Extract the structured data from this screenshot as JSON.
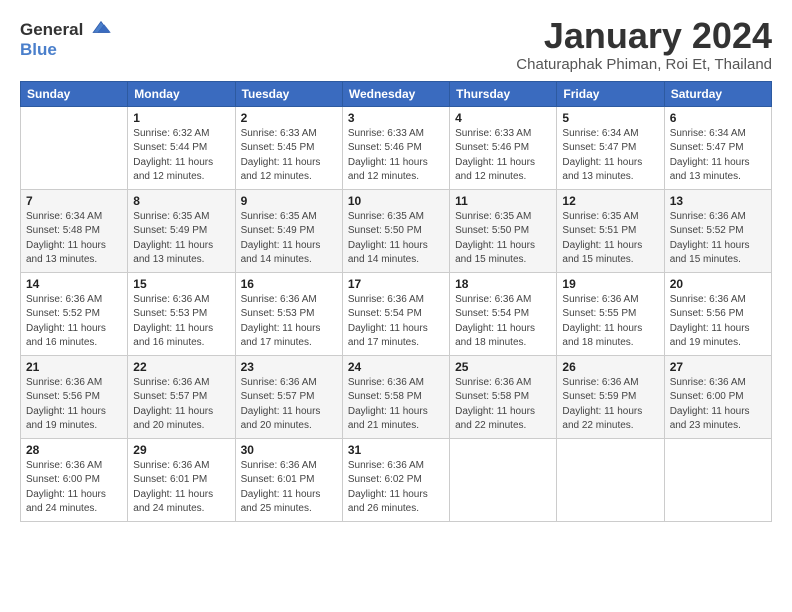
{
  "header": {
    "logo_line1": "General",
    "logo_line2": "Blue",
    "title": "January 2024",
    "subtitle": "Chaturaphak Phiman, Roi Et, Thailand"
  },
  "weekdays": [
    "Sunday",
    "Monday",
    "Tuesday",
    "Wednesday",
    "Thursday",
    "Friday",
    "Saturday"
  ],
  "weeks": [
    [
      {
        "day": "",
        "info": ""
      },
      {
        "day": "1",
        "info": "Sunrise: 6:32 AM\nSunset: 5:44 PM\nDaylight: 11 hours\nand 12 minutes."
      },
      {
        "day": "2",
        "info": "Sunrise: 6:33 AM\nSunset: 5:45 PM\nDaylight: 11 hours\nand 12 minutes."
      },
      {
        "day": "3",
        "info": "Sunrise: 6:33 AM\nSunset: 5:46 PM\nDaylight: 11 hours\nand 12 minutes."
      },
      {
        "day": "4",
        "info": "Sunrise: 6:33 AM\nSunset: 5:46 PM\nDaylight: 11 hours\nand 12 minutes."
      },
      {
        "day": "5",
        "info": "Sunrise: 6:34 AM\nSunset: 5:47 PM\nDaylight: 11 hours\nand 13 minutes."
      },
      {
        "day": "6",
        "info": "Sunrise: 6:34 AM\nSunset: 5:47 PM\nDaylight: 11 hours\nand 13 minutes."
      }
    ],
    [
      {
        "day": "7",
        "info": "Sunrise: 6:34 AM\nSunset: 5:48 PM\nDaylight: 11 hours\nand 13 minutes."
      },
      {
        "day": "8",
        "info": "Sunrise: 6:35 AM\nSunset: 5:49 PM\nDaylight: 11 hours\nand 13 minutes."
      },
      {
        "day": "9",
        "info": "Sunrise: 6:35 AM\nSunset: 5:49 PM\nDaylight: 11 hours\nand 14 minutes."
      },
      {
        "day": "10",
        "info": "Sunrise: 6:35 AM\nSunset: 5:50 PM\nDaylight: 11 hours\nand 14 minutes."
      },
      {
        "day": "11",
        "info": "Sunrise: 6:35 AM\nSunset: 5:50 PM\nDaylight: 11 hours\nand 15 minutes."
      },
      {
        "day": "12",
        "info": "Sunrise: 6:35 AM\nSunset: 5:51 PM\nDaylight: 11 hours\nand 15 minutes."
      },
      {
        "day": "13",
        "info": "Sunrise: 6:36 AM\nSunset: 5:52 PM\nDaylight: 11 hours\nand 15 minutes."
      }
    ],
    [
      {
        "day": "14",
        "info": "Sunrise: 6:36 AM\nSunset: 5:52 PM\nDaylight: 11 hours\nand 16 minutes."
      },
      {
        "day": "15",
        "info": "Sunrise: 6:36 AM\nSunset: 5:53 PM\nDaylight: 11 hours\nand 16 minutes."
      },
      {
        "day": "16",
        "info": "Sunrise: 6:36 AM\nSunset: 5:53 PM\nDaylight: 11 hours\nand 17 minutes."
      },
      {
        "day": "17",
        "info": "Sunrise: 6:36 AM\nSunset: 5:54 PM\nDaylight: 11 hours\nand 17 minutes."
      },
      {
        "day": "18",
        "info": "Sunrise: 6:36 AM\nSunset: 5:54 PM\nDaylight: 11 hours\nand 18 minutes."
      },
      {
        "day": "19",
        "info": "Sunrise: 6:36 AM\nSunset: 5:55 PM\nDaylight: 11 hours\nand 18 minutes."
      },
      {
        "day": "20",
        "info": "Sunrise: 6:36 AM\nSunset: 5:56 PM\nDaylight: 11 hours\nand 19 minutes."
      }
    ],
    [
      {
        "day": "21",
        "info": "Sunrise: 6:36 AM\nSunset: 5:56 PM\nDaylight: 11 hours\nand 19 minutes."
      },
      {
        "day": "22",
        "info": "Sunrise: 6:36 AM\nSunset: 5:57 PM\nDaylight: 11 hours\nand 20 minutes."
      },
      {
        "day": "23",
        "info": "Sunrise: 6:36 AM\nSunset: 5:57 PM\nDaylight: 11 hours\nand 20 minutes."
      },
      {
        "day": "24",
        "info": "Sunrise: 6:36 AM\nSunset: 5:58 PM\nDaylight: 11 hours\nand 21 minutes."
      },
      {
        "day": "25",
        "info": "Sunrise: 6:36 AM\nSunset: 5:58 PM\nDaylight: 11 hours\nand 22 minutes."
      },
      {
        "day": "26",
        "info": "Sunrise: 6:36 AM\nSunset: 5:59 PM\nDaylight: 11 hours\nand 22 minutes."
      },
      {
        "day": "27",
        "info": "Sunrise: 6:36 AM\nSunset: 6:00 PM\nDaylight: 11 hours\nand 23 minutes."
      }
    ],
    [
      {
        "day": "28",
        "info": "Sunrise: 6:36 AM\nSunset: 6:00 PM\nDaylight: 11 hours\nand 24 minutes."
      },
      {
        "day": "29",
        "info": "Sunrise: 6:36 AM\nSunset: 6:01 PM\nDaylight: 11 hours\nand 24 minutes."
      },
      {
        "day": "30",
        "info": "Sunrise: 6:36 AM\nSunset: 6:01 PM\nDaylight: 11 hours\nand 25 minutes."
      },
      {
        "day": "31",
        "info": "Sunrise: 6:36 AM\nSunset: 6:02 PM\nDaylight: 11 hours\nand 26 minutes."
      },
      {
        "day": "",
        "info": ""
      },
      {
        "day": "",
        "info": ""
      },
      {
        "day": "",
        "info": ""
      }
    ]
  ]
}
